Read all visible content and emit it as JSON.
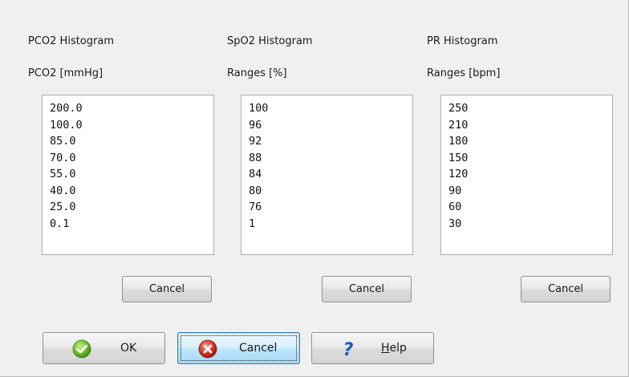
{
  "columns": [
    {
      "title": "PCO2 Histogram",
      "subtitle": "PCO2 [mmHg]",
      "values": [
        "200.0",
        "100.0",
        "85.0",
        "70.0",
        "55.0",
        "40.0",
        "25.0",
        "0.1"
      ],
      "cancel_label": "Cancel"
    },
    {
      "title": "SpO2 Histogram",
      "subtitle": "Ranges [%]",
      "values": [
        "100",
        "96",
        "92",
        "88",
        "84",
        "80",
        "76",
        "1"
      ],
      "cancel_label": "Cancel"
    },
    {
      "title": "PR Histogram",
      "subtitle": "Ranges [bpm]",
      "values": [
        "250",
        "210",
        "180",
        "150",
        "120",
        "90",
        "60",
        "30"
      ],
      "cancel_label": "Cancel"
    }
  ],
  "footer": {
    "ok_label": "OK",
    "ok_icon": "checkmark-icon",
    "cancel_label": "Cancel",
    "cancel_icon": "error-x-icon",
    "help_label_mnemonic": "H",
    "help_label_rest": "elp",
    "help_icon": "question-mark-icon"
  },
  "colors": {
    "ok_icon_green": "#6fbf2e",
    "cancel_icon_red": "#d9332b",
    "help_icon_blue": "#1a57c7"
  }
}
